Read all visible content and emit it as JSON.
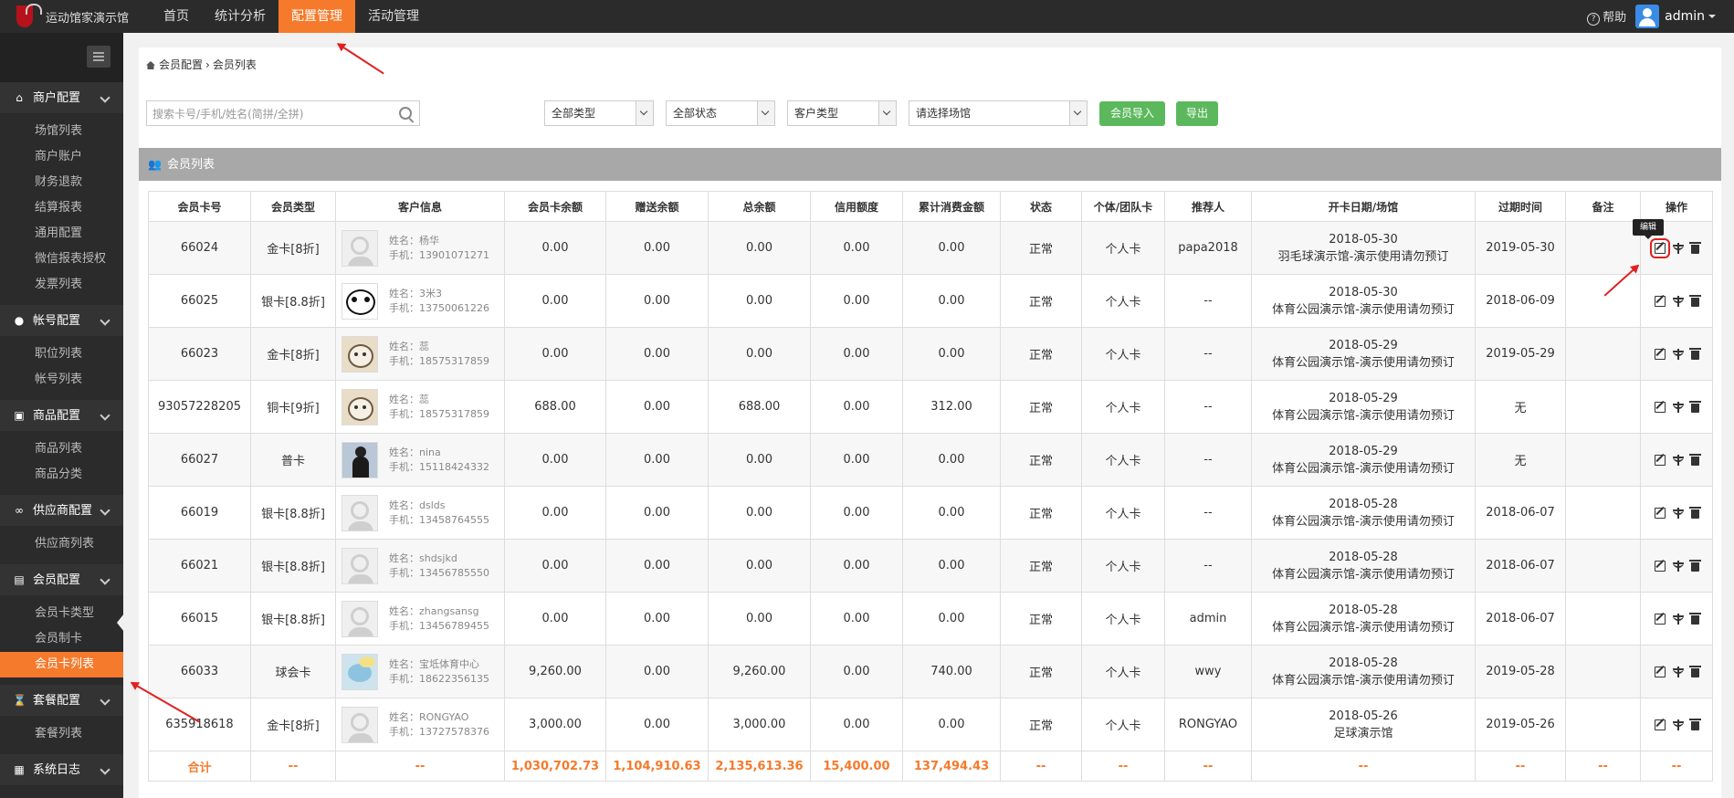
{
  "app": {
    "title": "运动馆家演示馆",
    "nav": [
      "首页",
      "统计分析",
      "配置管理",
      "活动管理"
    ],
    "nav_active_index": 2,
    "help_label": "帮助",
    "user": "admin",
    "accent_color": "#f57a2b"
  },
  "sidebar": {
    "groups": [
      {
        "label": "商户配置",
        "icon": "home-icon",
        "items": [
          "场馆列表",
          "商户账户",
          "财务退款",
          "结算报表",
          "通用配置",
          "微信报表授权",
          "发票列表"
        ]
      },
      {
        "label": "帐号配置",
        "icon": "user-icon",
        "items": [
          "职位列表",
          "帐号列表"
        ]
      },
      {
        "label": "商品配置",
        "icon": "shop-icon",
        "items": [
          "商品列表",
          "商品分类"
        ]
      },
      {
        "label": "供应商配置",
        "icon": "link-icon",
        "items": [
          "供应商列表"
        ]
      },
      {
        "label": "会员配置",
        "icon": "id-card-icon",
        "items": [
          "会员卡类型",
          "会员制卡",
          "会员卡列表"
        ]
      },
      {
        "label": "套餐配置",
        "icon": "hourglass-icon",
        "items": [
          "套餐列表"
        ]
      },
      {
        "label": "系统日志",
        "icon": "log-icon",
        "items": []
      }
    ],
    "active_item": "会员卡列表"
  },
  "breadcrumb": {
    "root": "会员配置",
    "sep": "›",
    "current": "会员列表"
  },
  "toolbar": {
    "search_placeholder": "搜索卡号/手机/姓名(简拼/全拼)",
    "filter_type": "全部类型",
    "filter_status": "全部状态",
    "filter_customer": "客户类型",
    "filter_venue": "请选择场馆",
    "import_label": "会员导入",
    "export_label": "导出"
  },
  "panel": {
    "title": "会员列表"
  },
  "table": {
    "headers": [
      "会员卡号",
      "会员类型",
      "客户信息",
      "会员卡余额",
      "赠送余额",
      "总余额",
      "信用额度",
      "累计消费金额",
      "状态",
      "个体/团队卡",
      "推荐人",
      "开卡日期/场馆",
      "过期时间",
      "备注",
      "操作"
    ],
    "rows": [
      {
        "card": "66024",
        "type": "金卡[8折]",
        "avatar": "default",
        "name": "姓名：杨华",
        "phone": "手机：13901071271",
        "balance": "0.00",
        "gift": "0.00",
        "total": "0.00",
        "credit": "0.00",
        "spent": "0.00",
        "status": "正常",
        "kind": "个人卡",
        "referrer": "papa2018",
        "open_date": "2018-05-30",
        "venue": "羽毛球演示馆-演示使用请勿预订",
        "expire": "2019-05-30",
        "note": ""
      },
      {
        "card": "66025",
        "type": "银卡[8.8折]",
        "avatar": "panda",
        "name": "姓名：3米3",
        "phone": "手机：13750061226",
        "balance": "0.00",
        "gift": "0.00",
        "total": "0.00",
        "credit": "0.00",
        "spent": "0.00",
        "status": "正常",
        "kind": "个人卡",
        "referrer": "--",
        "open_date": "2018-05-30",
        "venue": "体育公园演示馆-演示使用请勿预订",
        "expire": "2018-06-09",
        "note": ""
      },
      {
        "card": "66023",
        "type": "金卡[8折]",
        "avatar": "cat",
        "name": "姓名：蕊",
        "phone": "手机：18575317859",
        "balance": "0.00",
        "gift": "0.00",
        "total": "0.00",
        "credit": "0.00",
        "spent": "0.00",
        "status": "正常",
        "kind": "个人卡",
        "referrer": "--",
        "open_date": "2018-05-29",
        "venue": "体育公园演示馆-演示使用请勿预订",
        "expire": "2019-05-29",
        "note": ""
      },
      {
        "card": "93057228205",
        "type": "铜卡[9折]",
        "avatar": "cat",
        "name": "姓名：蕊",
        "phone": "手机：18575317859",
        "balance": "688.00",
        "gift": "0.00",
        "total": "688.00",
        "credit": "0.00",
        "spent": "312.00",
        "status": "正常",
        "kind": "个人卡",
        "referrer": "--",
        "open_date": "2018-05-29",
        "venue": "体育公园演示馆-演示使用请勿预订",
        "expire": "无",
        "note": ""
      },
      {
        "card": "66027",
        "type": "普卡",
        "avatar": "person",
        "name": "姓名：nina",
        "phone": "手机：15118424332",
        "balance": "0.00",
        "gift": "0.00",
        "total": "0.00",
        "credit": "0.00",
        "spent": "0.00",
        "status": "正常",
        "kind": "个人卡",
        "referrer": "--",
        "open_date": "2018-05-29",
        "venue": "体育公园演示馆-演示使用请勿预订",
        "expire": "无",
        "note": ""
      },
      {
        "card": "66019",
        "type": "银卡[8.8折]",
        "avatar": "default",
        "name": "姓名：dslds",
        "phone": "手机：13458764555",
        "balance": "0.00",
        "gift": "0.00",
        "total": "0.00",
        "credit": "0.00",
        "spent": "0.00",
        "status": "正常",
        "kind": "个人卡",
        "referrer": "--",
        "open_date": "2018-05-28",
        "venue": "体育公园演示馆-演示使用请勿预订",
        "expire": "2018-06-07",
        "note": ""
      },
      {
        "card": "66021",
        "type": "银卡[8.8折]",
        "avatar": "default",
        "name": "姓名：shdsjkd",
        "phone": "手机：13456785550",
        "balance": "0.00",
        "gift": "0.00",
        "total": "0.00",
        "credit": "0.00",
        "spent": "0.00",
        "status": "正常",
        "kind": "个人卡",
        "referrer": "--",
        "open_date": "2018-05-28",
        "venue": "体育公园演示馆-演示使用请勿预订",
        "expire": "2018-06-07",
        "note": ""
      },
      {
        "card": "66015",
        "type": "银卡[8.8折]",
        "avatar": "default",
        "name": "姓名：zhangsansg",
        "phone": "手机：13456789455",
        "balance": "0.00",
        "gift": "0.00",
        "total": "0.00",
        "credit": "0.00",
        "spent": "0.00",
        "status": "正常",
        "kind": "个人卡",
        "referrer": "admin",
        "open_date": "2018-05-28",
        "venue": "体育公园演示馆-演示使用请勿预订",
        "expire": "2018-06-07",
        "note": ""
      },
      {
        "card": "66033",
        "type": "球会卡",
        "avatar": "blue",
        "name": "姓名：宝坻体育中心",
        "phone": "手机：18622356135",
        "balance": "9,260.00",
        "gift": "0.00",
        "total": "9,260.00",
        "credit": "0.00",
        "spent": "740.00",
        "status": "正常",
        "kind": "个人卡",
        "referrer": "wwy",
        "open_date": "2018-05-28",
        "venue": "体育公园演示馆-演示使用请勿预订",
        "expire": "2019-05-28",
        "note": ""
      },
      {
        "card": "635918618",
        "type": "金卡[8折]",
        "avatar": "default",
        "name": "姓名：RONGYAO",
        "phone": "手机：13727578376",
        "balance": "3,000.00",
        "gift": "0.00",
        "total": "3,000.00",
        "credit": "0.00",
        "spent": "0.00",
        "status": "正常",
        "kind": "个人卡",
        "referrer": "RONGYAO",
        "open_date": "2018-05-26",
        "venue": "足球演示馆",
        "expire": "2019-05-26",
        "note": ""
      }
    ],
    "total_row": {
      "label": "合计",
      "dash": "--",
      "balance": "1,030,702.73",
      "gift": "1,104,910.63",
      "total": "2,135,613.36",
      "credit": "15,400.00",
      "spent": "137,494.43"
    }
  },
  "tooltip": {
    "label": "编辑"
  }
}
